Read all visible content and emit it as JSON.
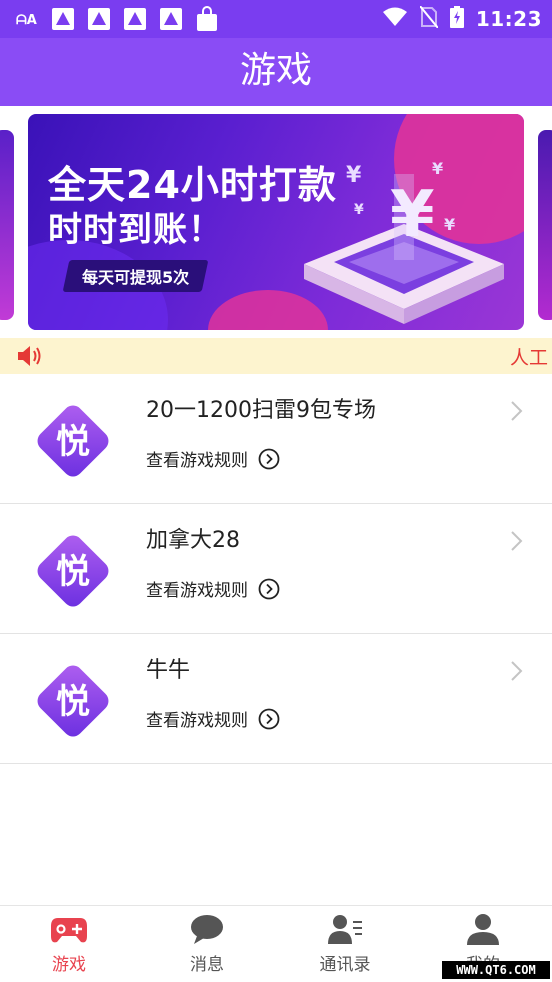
{
  "status_bar": {
    "time": "11:23",
    "left_icons": [
      "font-a-icon",
      "app-icon",
      "app-icon",
      "app-icon",
      "app-icon",
      "shopping-bag-icon"
    ],
    "right_icons": [
      "wifi-icon",
      "no-sim-icon",
      "battery-charging-icon"
    ]
  },
  "header": {
    "title": "游戏"
  },
  "banner": {
    "headline_1": "全天24小时打款",
    "headline_2": "时时到账！",
    "badge": "每天可提现5次"
  },
  "notice": {
    "text": "人工"
  },
  "games": [
    {
      "name": "20一1200扫雷9包专场",
      "rules_label": "查看游戏规则",
      "logo_char": "悦"
    },
    {
      "name": "加拿大28",
      "rules_label": "查看游戏规则",
      "logo_char": "悦"
    },
    {
      "name": "牛牛",
      "rules_label": "查看游戏规则",
      "logo_char": "悦"
    }
  ],
  "bottom_nav": [
    {
      "label": "游戏",
      "icon": "gamepad-icon",
      "active": true
    },
    {
      "label": "消息",
      "icon": "chat-bubble-icon",
      "active": false
    },
    {
      "label": "通讯录",
      "icon": "contacts-icon",
      "active": false
    },
    {
      "label": "我的",
      "icon": "profile-icon",
      "active": false
    }
  ],
  "watermark": "WWW.QT6.COM",
  "colors": {
    "primary": "#8a4cf5",
    "status_bar": "#7a3df0",
    "active_tab": "#e8434f",
    "notice_bg": "#fdf4cf",
    "notice_text": "#e53935"
  }
}
